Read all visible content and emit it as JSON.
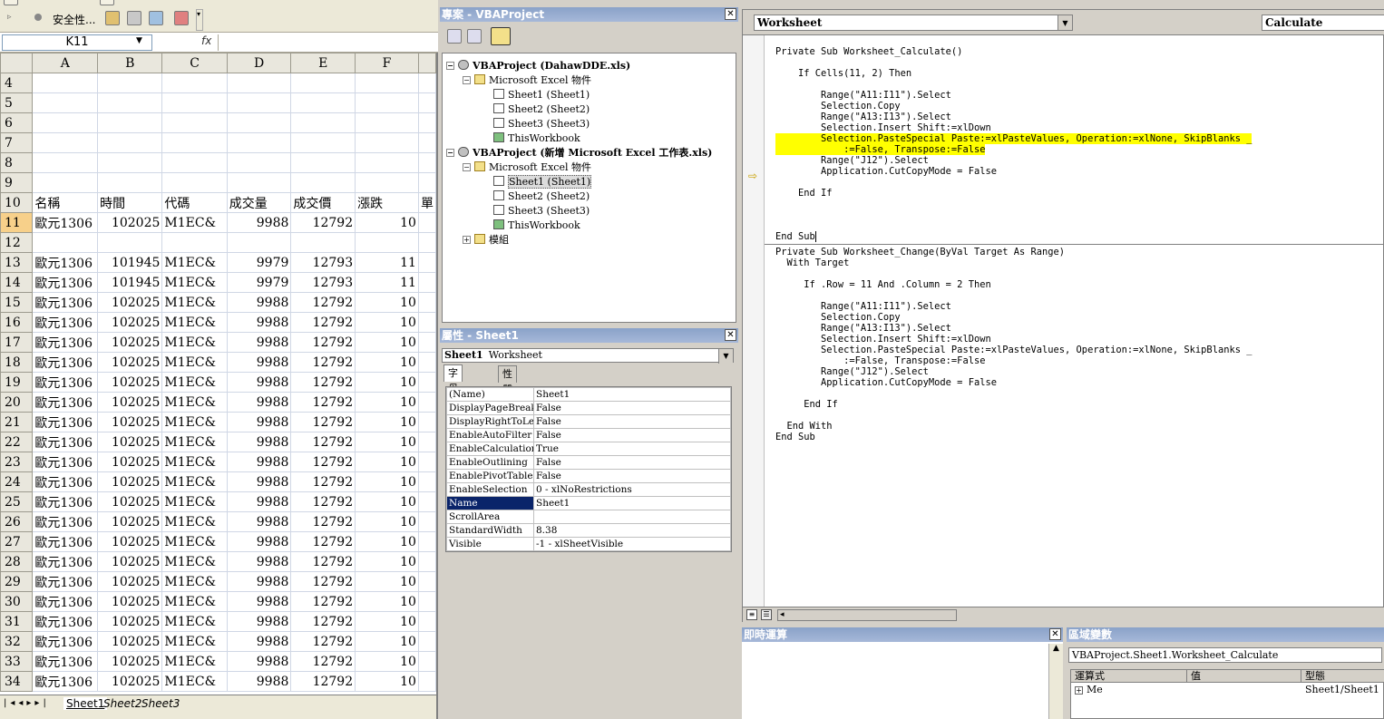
{
  "excel": {
    "toolbar": {
      "security_label": "安全性..."
    },
    "name_box": "K11",
    "fx_label": "fx",
    "columns": [
      "A",
      "B",
      "C",
      "D",
      "E",
      "F"
    ],
    "header_row": {
      "row": "10",
      "cells": [
        "名稱",
        "時間",
        "代碼",
        "成交量",
        "成交價",
        "漲跌",
        "單"
      ]
    },
    "rows": [
      {
        "r": "4",
        "c": [
          "",
          "",
          "",
          "",
          "",
          ""
        ]
      },
      {
        "r": "5",
        "c": [
          "",
          "",
          "",
          "",
          "",
          ""
        ]
      },
      {
        "r": "6",
        "c": [
          "",
          "",
          "",
          "",
          "",
          ""
        ]
      },
      {
        "r": "7",
        "c": [
          "",
          "",
          "",
          "",
          "",
          ""
        ]
      },
      {
        "r": "8",
        "c": [
          "",
          "",
          "",
          "",
          "",
          ""
        ]
      },
      {
        "r": "9",
        "c": [
          "",
          "",
          "",
          "",
          "",
          ""
        ]
      },
      {
        "r": "11",
        "c": [
          "歐元1306",
          "102025",
          "M1EC&",
          "9988",
          "12792",
          "10"
        ]
      },
      {
        "r": "12",
        "c": [
          "",
          "",
          "",
          "",
          "",
          ""
        ]
      },
      {
        "r": "13",
        "c": [
          "歐元1306",
          "101945",
          "M1EC&",
          "9979",
          "12793",
          "11"
        ]
      },
      {
        "r": "14",
        "c": [
          "歐元1306",
          "101945",
          "M1EC&",
          "9979",
          "12793",
          "11"
        ]
      },
      {
        "r": "15",
        "c": [
          "歐元1306",
          "102025",
          "M1EC&",
          "9988",
          "12792",
          "10"
        ]
      },
      {
        "r": "16",
        "c": [
          "歐元1306",
          "102025",
          "M1EC&",
          "9988",
          "12792",
          "10"
        ]
      },
      {
        "r": "17",
        "c": [
          "歐元1306",
          "102025",
          "M1EC&",
          "9988",
          "12792",
          "10"
        ]
      },
      {
        "r": "18",
        "c": [
          "歐元1306",
          "102025",
          "M1EC&",
          "9988",
          "12792",
          "10"
        ]
      },
      {
        "r": "19",
        "c": [
          "歐元1306",
          "102025",
          "M1EC&",
          "9988",
          "12792",
          "10"
        ]
      },
      {
        "r": "20",
        "c": [
          "歐元1306",
          "102025",
          "M1EC&",
          "9988",
          "12792",
          "10"
        ]
      },
      {
        "r": "21",
        "c": [
          "歐元1306",
          "102025",
          "M1EC&",
          "9988",
          "12792",
          "10"
        ]
      },
      {
        "r": "22",
        "c": [
          "歐元1306",
          "102025",
          "M1EC&",
          "9988",
          "12792",
          "10"
        ]
      },
      {
        "r": "23",
        "c": [
          "歐元1306",
          "102025",
          "M1EC&",
          "9988",
          "12792",
          "10"
        ]
      },
      {
        "r": "24",
        "c": [
          "歐元1306",
          "102025",
          "M1EC&",
          "9988",
          "12792",
          "10"
        ]
      },
      {
        "r": "25",
        "c": [
          "歐元1306",
          "102025",
          "M1EC&",
          "9988",
          "12792",
          "10"
        ]
      },
      {
        "r": "26",
        "c": [
          "歐元1306",
          "102025",
          "M1EC&",
          "9988",
          "12792",
          "10"
        ]
      },
      {
        "r": "27",
        "c": [
          "歐元1306",
          "102025",
          "M1EC&",
          "9988",
          "12792",
          "10"
        ]
      },
      {
        "r": "28",
        "c": [
          "歐元1306",
          "102025",
          "M1EC&",
          "9988",
          "12792",
          "10"
        ]
      },
      {
        "r": "29",
        "c": [
          "歐元1306",
          "102025",
          "M1EC&",
          "9988",
          "12792",
          "10"
        ]
      },
      {
        "r": "30",
        "c": [
          "歐元1306",
          "102025",
          "M1EC&",
          "9988",
          "12792",
          "10"
        ]
      },
      {
        "r": "31",
        "c": [
          "歐元1306",
          "102025",
          "M1EC&",
          "9988",
          "12792",
          "10"
        ]
      },
      {
        "r": "32",
        "c": [
          "歐元1306",
          "102025",
          "M1EC&",
          "9988",
          "12792",
          "10"
        ]
      },
      {
        "r": "33",
        "c": [
          "歐元1306",
          "102025",
          "M1EC&",
          "9988",
          "12792",
          "10"
        ]
      },
      {
        "r": "34",
        "c": [
          "歐元1306",
          "102025",
          "M1EC&",
          "9988",
          "12792",
          "10"
        ]
      }
    ],
    "sheet_tabs": [
      "Sheet1",
      "Sheet2",
      "Sheet3"
    ]
  },
  "project": {
    "title": "專案 - VBAProject",
    "tree": [
      {
        "label": "VBAProject (DahawDDE.xls)",
        "kind": "proj",
        "bold": true,
        "pm": "−"
      },
      {
        "label": "Microsoft Excel 物件",
        "kind": "folder",
        "pm": "−"
      },
      {
        "label": "Sheet1 (Sheet1)",
        "kind": "sheet"
      },
      {
        "label": "Sheet2 (Sheet2)",
        "kind": "sheet"
      },
      {
        "label": "Sheet3 (Sheet3)",
        "kind": "sheet"
      },
      {
        "label": "ThisWorkbook",
        "kind": "wb"
      },
      {
        "label": "VBAProject (新增 Microsoft Excel 工作表.xls)",
        "kind": "proj",
        "bold": true,
        "pm": "−"
      },
      {
        "label": "Microsoft Excel 物件",
        "kind": "folder",
        "pm": "−"
      },
      {
        "label": "Sheet1 (Sheet1)",
        "kind": "sheet",
        "selected": true
      },
      {
        "label": "Sheet2 (Sheet2)",
        "kind": "sheet"
      },
      {
        "label": "Sheet3 (Sheet3)",
        "kind": "sheet"
      },
      {
        "label": "ThisWorkbook",
        "kind": "wb"
      },
      {
        "label": "模組",
        "kind": "folder",
        "pm": "+"
      }
    ]
  },
  "properties": {
    "title": "屬性 - Sheet1",
    "object_name": "Sheet1",
    "object_type": "Worksheet",
    "tabs": [
      "字母順序",
      "性質分類"
    ],
    "rows": [
      {
        "k": "(Name)",
        "v": "Sheet1"
      },
      {
        "k": "DisplayPageBreaks",
        "v": "False"
      },
      {
        "k": "DisplayRightToLeft",
        "v": "False"
      },
      {
        "k": "EnableAutoFilter",
        "v": "False"
      },
      {
        "k": "EnableCalculation",
        "v": "True"
      },
      {
        "k": "EnableOutlining",
        "v": "False"
      },
      {
        "k": "EnablePivotTable",
        "v": "False"
      },
      {
        "k": "EnableSelection",
        "v": "0 - xlNoRestrictions"
      },
      {
        "k": "Name",
        "v": "Sheet1",
        "selected": true
      },
      {
        "k": "ScrollArea",
        "v": ""
      },
      {
        "k": "StandardWidth",
        "v": "8.38"
      },
      {
        "k": "Visible",
        "v": "-1 - xlSheetVisible"
      }
    ]
  },
  "code_window": {
    "object_combo": "Worksheet",
    "proc_combo": "Calculate",
    "proc1_before": "Private Sub Worksheet_Calculate()\n\n    If Cells(11, 2) Then\n\n        Range(\"A11:I11\").Select\n        Selection.Copy\n        Range(\"A13:I13\").Select\n        Selection.Insert Shift:=xlDown\n",
    "proc1_highlight": "        Selection.PasteSpecial Paste:=xlPasteValues, Operation:=xlNone, SkipBlanks _\n            :=False, Transpose:=False",
    "proc1_after": "\n        Range(\"J12\").Select\n        Application.CutCopyMode = False\n\n    End If\n\n\n\nEnd Sub",
    "proc2": "Private Sub Worksheet_Change(ByVal Target As Range)\n  With Target\n\n     If .Row = 11 And .Column = 2 Then\n\n        Range(\"A11:I11\").Select\n        Selection.Copy\n        Range(\"A13:I13\").Select\n        Selection.Insert Shift:=xlDown\n        Selection.PasteSpecial Paste:=xlPasteValues, Operation:=xlNone, SkipBlanks _\n            :=False, Transpose:=False\n        Range(\"J12\").Select\n        Application.CutCopyMode = False\n\n     End If\n\n  End With\nEnd Sub"
  },
  "immediate": {
    "title": "即時運算"
  },
  "locals": {
    "title": "區域變數",
    "context": "VBAProject.Sheet1.Worksheet_Calculate",
    "headers": [
      "運算式",
      "值",
      "型態"
    ],
    "row": {
      "expr": "Me",
      "value": "",
      "type": "Sheet1/Sheet1"
    }
  },
  "colors": {
    "highlight": "#ffff00",
    "titlebar": "#8aa2c8",
    "selection": "#0a246a"
  }
}
